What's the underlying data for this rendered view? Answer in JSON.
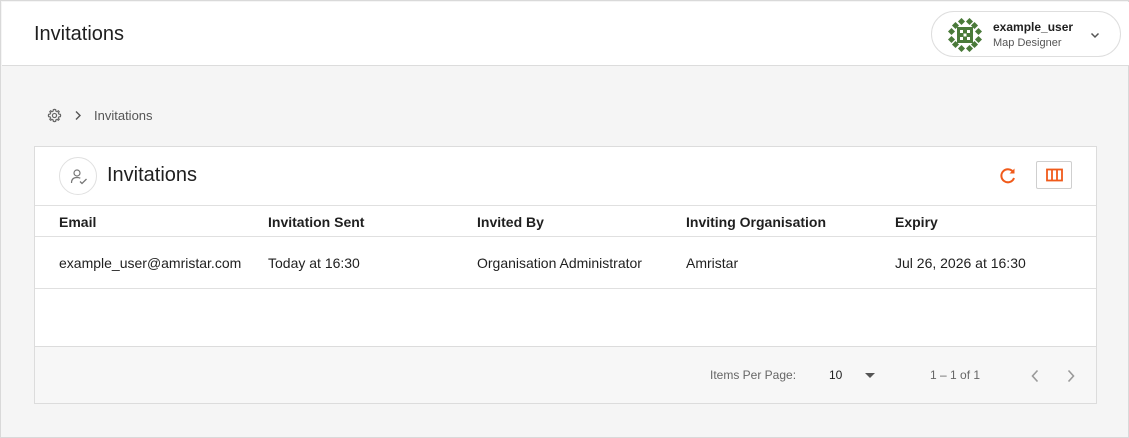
{
  "header": {
    "title": "Invitations",
    "user": {
      "name": "example_user",
      "role": "Map Designer"
    }
  },
  "breadcrumb": {
    "current": "Invitations"
  },
  "card": {
    "title": "Invitations",
    "columns": [
      "Email",
      "Invitation Sent",
      "Invited By",
      "Inviting Organisation",
      "Expiry"
    ],
    "rows": [
      [
        "example_user@amristar.com",
        "Today at 16:30",
        "Organisation Administrator",
        "Amristar",
        "Jul 26, 2026 at 16:30"
      ]
    ]
  },
  "pagination": {
    "items_per_page_label": "Items Per Page:",
    "items_per_page": "10",
    "range": "1 – 1 of 1"
  },
  "colors": {
    "accent": "#f05a1a",
    "avatar": "#4a7a3a"
  },
  "icons": [
    "user-chevron-down-icon",
    "gear-icon",
    "chevron-right-icon",
    "invitation-icon",
    "refresh-icon",
    "columns-icon",
    "dropdown-caret-icon",
    "chevron-left-icon"
  ]
}
